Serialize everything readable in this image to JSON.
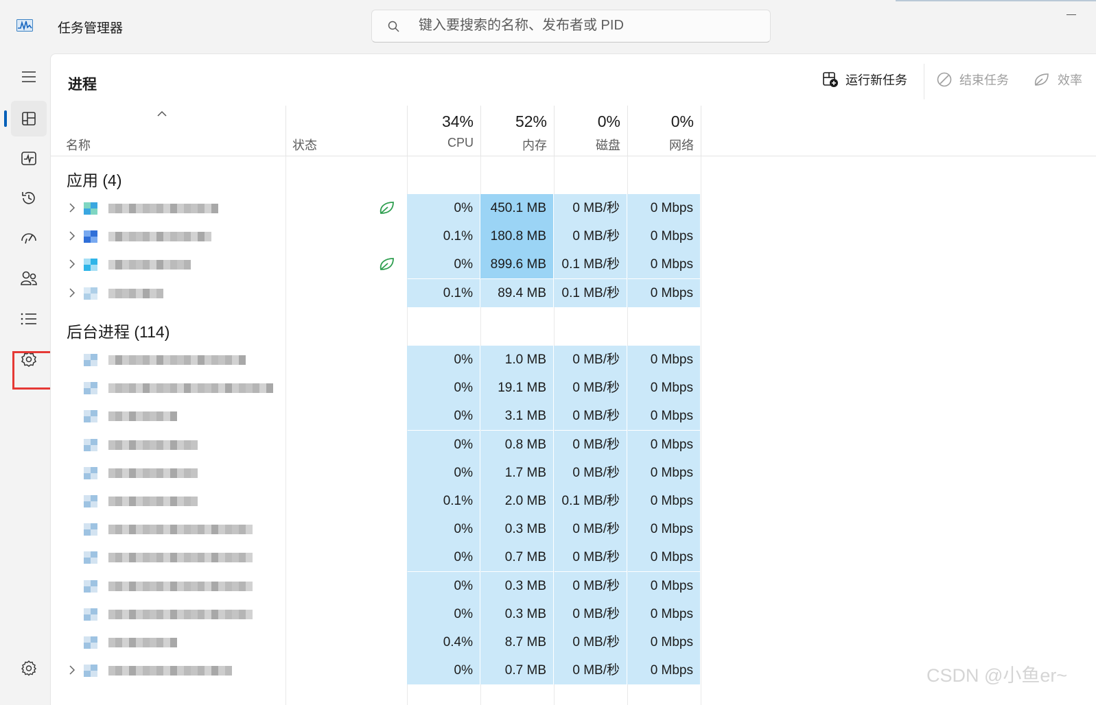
{
  "window": {
    "title": "任务管理器",
    "search_placeholder": "键入要搜索的名称、发布者或 PID"
  },
  "nav": [
    {
      "name": "hamburger-menu-icon"
    },
    {
      "name": "processes-icon",
      "active": true
    },
    {
      "name": "performance-icon"
    },
    {
      "name": "app-history-icon"
    },
    {
      "name": "startup-apps-icon"
    },
    {
      "name": "users-icon"
    },
    {
      "name": "details-icon"
    },
    {
      "name": "services-icon",
      "highlighted": true
    },
    {
      "name": "settings-icon"
    }
  ],
  "page": {
    "title": "进程",
    "run_task": "运行新任务",
    "end_task": "结束任务",
    "efficiency": "效率"
  },
  "columns": {
    "name": "名称",
    "status": "状态",
    "cpu_pct": "34%",
    "cpu": "CPU",
    "mem_pct": "52%",
    "mem": "内存",
    "disk_pct": "0%",
    "disk": "磁盘",
    "net_pct": "0%",
    "net": "网络"
  },
  "groups": {
    "apps": "应用 (4)",
    "background": "后台进程 (114)"
  },
  "apps": [
    {
      "cpu": "0%",
      "mem": "450.1 MB",
      "disk": "0 MB/秒",
      "net": "0 Mbps",
      "eco": true,
      "mem_heat": 2
    },
    {
      "cpu": "0.1%",
      "mem": "180.8 MB",
      "disk": "0 MB/秒",
      "net": "0 Mbps",
      "eco": false,
      "mem_heat": 2
    },
    {
      "cpu": "0%",
      "mem": "899.6 MB",
      "disk": "0.1 MB/秒",
      "net": "0 Mbps",
      "eco": true,
      "mem_heat": 2
    },
    {
      "cpu": "0.1%",
      "mem": "89.4 MB",
      "disk": "0.1 MB/秒",
      "net": "0 Mbps",
      "eco": false,
      "mem_heat": 1
    }
  ],
  "background": [
    {
      "cpu": "0%",
      "mem": "1.0 MB",
      "disk": "0 MB/秒",
      "net": "0 Mbps"
    },
    {
      "cpu": "0%",
      "mem": "19.1 MB",
      "disk": "0 MB/秒",
      "net": "0 Mbps"
    },
    {
      "cpu": "0%",
      "mem": "3.1 MB",
      "disk": "0 MB/秒",
      "net": "0 Mbps"
    },
    {
      "cpu": "0%",
      "mem": "0.8 MB",
      "disk": "0 MB/秒",
      "net": "0 Mbps"
    },
    {
      "cpu": "0%",
      "mem": "1.7 MB",
      "disk": "0 MB/秒",
      "net": "0 Mbps"
    },
    {
      "cpu": "0.1%",
      "mem": "2.0 MB",
      "disk": "0.1 MB/秒",
      "net": "0 Mbps"
    },
    {
      "cpu": "0%",
      "mem": "0.3 MB",
      "disk": "0 MB/秒",
      "net": "0 Mbps"
    },
    {
      "cpu": "0%",
      "mem": "0.7 MB",
      "disk": "0 MB/秒",
      "net": "0 Mbps"
    },
    {
      "cpu": "0%",
      "mem": "0.3 MB",
      "disk": "0 MB/秒",
      "net": "0 Mbps"
    },
    {
      "cpu": "0%",
      "mem": "0.3 MB",
      "disk": "0 MB/秒",
      "net": "0 Mbps"
    },
    {
      "cpu": "0.4%",
      "mem": "8.7 MB",
      "disk": "0 MB/秒",
      "net": "0 Mbps"
    },
    {
      "cpu": "0%",
      "mem": "0.7 MB",
      "disk": "0 MB/秒",
      "net": "0 Mbps"
    }
  ],
  "watermark": "CSDN @小鱼er~",
  "colors": {
    "accent": "#005fb8",
    "heat_light": "#cbe8f9",
    "heat_strong": "#9bd4f5",
    "highlight_box": "#e53935",
    "eco_leaf": "#2e9e4f"
  }
}
